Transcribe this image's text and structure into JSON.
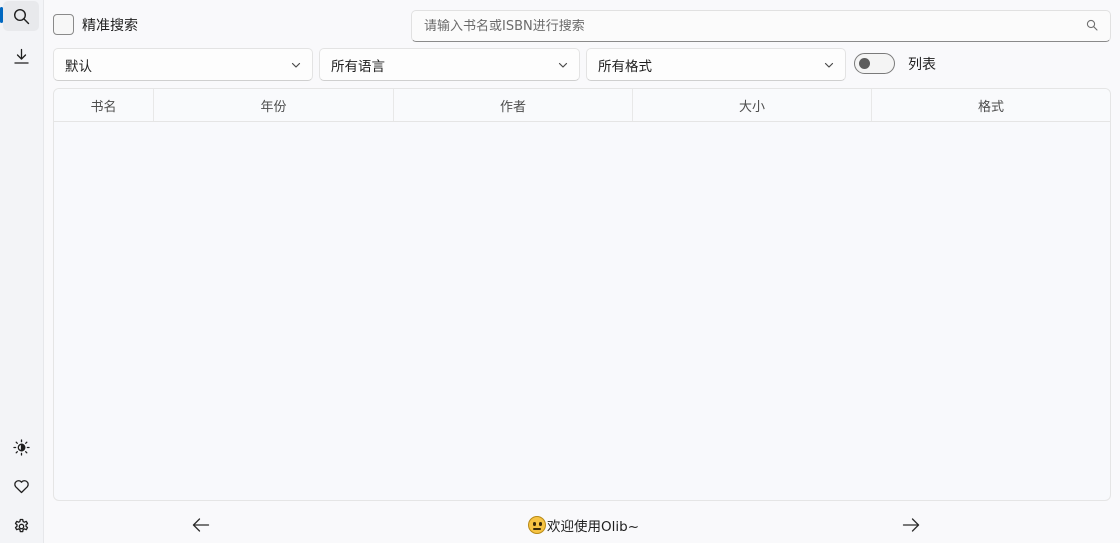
{
  "sidebar": {
    "top_items": [
      {
        "name": "search",
        "active": true
      },
      {
        "name": "download",
        "active": false
      }
    ],
    "bottom_items": [
      {
        "name": "theme"
      },
      {
        "name": "favorites"
      },
      {
        "name": "settings"
      }
    ],
    "accent_color": "#0067c0"
  },
  "filters": {
    "exact_search_label": "精准搜索",
    "exact_search_checked": false,
    "search_placeholder": "请输入书名或ISBN进行搜索",
    "search_value": "",
    "sort_selected": "默认",
    "language_selected": "所有语言",
    "format_selected": "所有格式",
    "list_toggle_label": "列表",
    "list_toggle_on": false
  },
  "table": {
    "columns": [
      "书名",
      "年份",
      "作者",
      "大小",
      "格式"
    ],
    "rows": []
  },
  "footer": {
    "welcome_text": "欢迎使用Olib~",
    "emoji": "neutral-face-icon"
  }
}
